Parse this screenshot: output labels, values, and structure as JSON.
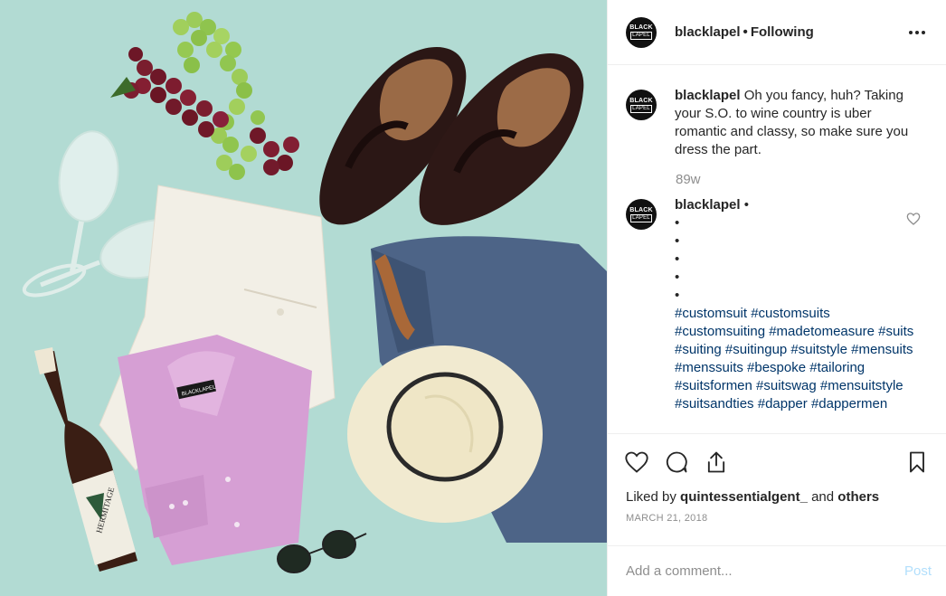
{
  "post": {
    "username": "blacklapel",
    "follow_status": "Following",
    "avatar_text_top": "BLACK",
    "avatar_text_bottom": "LAPEL"
  },
  "caption": {
    "username": "blacklapel",
    "text": "Oh you fancy, huh? Taking your S.O. to wine country is uber romantic and classy, so make sure you dress the part.",
    "time_ago": "89w"
  },
  "comment": {
    "username": "blacklapel",
    "bullets": [
      "•",
      "•",
      "•",
      "•",
      "•"
    ],
    "hashtags": "#customsuit #customsuits #customsuiting #madetomeasure #suits #suiting #suitingup #suitstyle #mensuits #menssuits #bespoke #tailoring #suitsformen #suitswag #mensuitstyle #suitsandties #dapper #dappermen"
  },
  "likes": {
    "prefix": "Liked by",
    "user": "quintessentialgent_",
    "joiner": "and",
    "others": "others"
  },
  "date": "MARCH 21, 2018",
  "add_comment": {
    "placeholder": "Add a comment...",
    "post_label": "Post"
  },
  "photo": {
    "shirt_label": "BLACKLAPEL",
    "wine_label": "HERMITAGE"
  },
  "colors": {
    "background_teal": "#b2dbd3",
    "hashtag_link": "#003569",
    "post_button_disabled": "#b2dffc",
    "muted_text": "#8e8e8e"
  }
}
